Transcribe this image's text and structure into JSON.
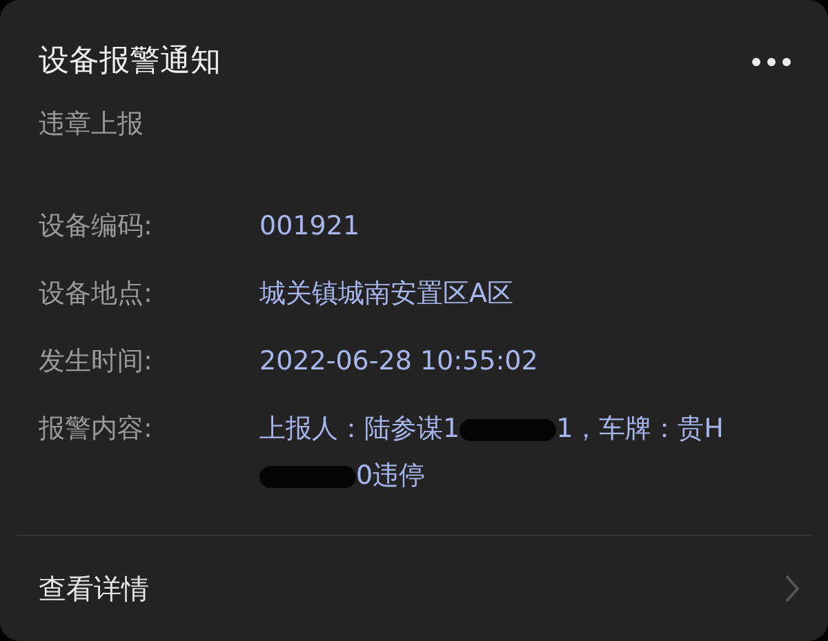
{
  "header": {
    "title": "设备报警通知",
    "subtitle": "违章上报"
  },
  "fields": [
    {
      "label": "设备编码:",
      "value": [
        {
          "kind": "text",
          "text": "001921"
        }
      ]
    },
    {
      "label": "设备地点:",
      "value": [
        {
          "kind": "text",
          "text": "城关镇城南安置区A区"
        }
      ]
    },
    {
      "label": "发生时间:",
      "value": [
        {
          "kind": "text",
          "text": "2022-06-28 10:55:02"
        }
      ]
    },
    {
      "label": "报警内容:",
      "value": [
        {
          "kind": "text",
          "text": "上报人：陆参谋1"
        },
        {
          "kind": "redacted"
        },
        {
          "kind": "text",
          "text": "1，车牌：贵H"
        },
        {
          "kind": "redacted"
        },
        {
          "kind": "text",
          "text": "0违停"
        }
      ]
    }
  ],
  "footer": {
    "link": "查看详情"
  }
}
